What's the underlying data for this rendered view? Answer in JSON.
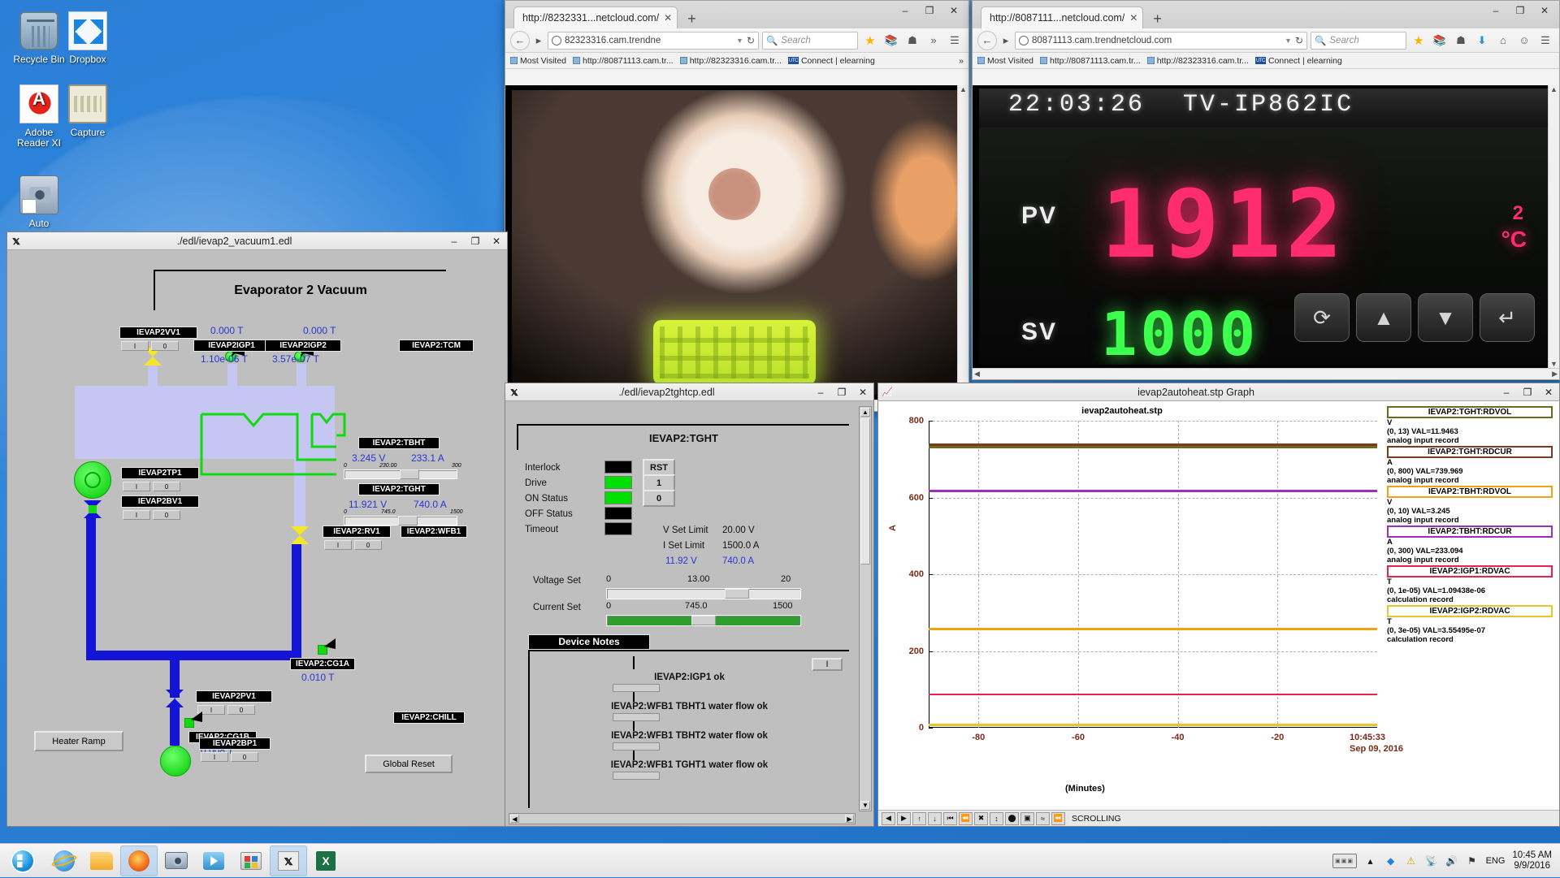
{
  "desktop": {
    "icons": [
      {
        "name": "recycle-bin",
        "label": "Recycle Bin"
      },
      {
        "name": "dropbox",
        "label": "Dropbox"
      },
      {
        "name": "adobe-reader",
        "label": "Adobe\nReader XI"
      },
      {
        "name": "capture",
        "label": "Capture"
      },
      {
        "name": "auto",
        "label": "Auto"
      }
    ]
  },
  "browser1": {
    "tab_label": "http://8232331...netcloud.com/",
    "new_tab": "+",
    "url": "82323316.cam.trendne",
    "url_bold": "trendne",
    "search_placeholder": "Search",
    "bookmarks": [
      {
        "label": "Most Visited"
      },
      {
        "label": "http://80871113.cam.tr..."
      },
      {
        "label": "http://82323316.cam.tr..."
      },
      {
        "label": "Connect | elearning"
      }
    ],
    "bookmarks_overflow": "»",
    "window_buttons": {
      "minimize": "–",
      "maximize": "❐",
      "close": "✕"
    }
  },
  "browser2": {
    "tab_label": "http://8087111...netcloud.com/",
    "new_tab": "+",
    "url": "80871113.cam.trendnetcloud.com",
    "search_placeholder": "Search",
    "bookmarks": [
      {
        "label": "Most Visited"
      },
      {
        "label": "http://80871113.cam.tr..."
      },
      {
        "label": "http://82323316.cam.tr..."
      },
      {
        "label": "Connect | elearning"
      }
    ],
    "window_buttons": {
      "minimize": "–",
      "maximize": "❐",
      "close": "✕"
    },
    "camera": {
      "timestamp": "22:03:26",
      "camera_id": "TV-IP862IC",
      "pv_label": "PV",
      "sv_label": "SV",
      "pv_value": "1912",
      "sv_value": "1000",
      "unit": "°C",
      "channel": "2",
      "keys": [
        "⟳",
        "▲",
        "▼",
        "↵"
      ]
    }
  },
  "vacuum_window": {
    "title": "./edl/ievap2_vacuum1.edl",
    "header": "Evaporator 2 Vacuum",
    "window_buttons": {
      "minimize": "–",
      "maximize": "❐",
      "close": "✕"
    },
    "devices": [
      {
        "name": "IEVAP2VV1",
        "on": "I",
        "off": "0"
      },
      {
        "name": "IEVAP2IGP1",
        "on": "I",
        "off": "0"
      },
      {
        "name": "IEVAP2IGP2",
        "on": "I",
        "off": "0"
      },
      {
        "name": "IEVAP2TP1",
        "on": "I",
        "off": "0"
      },
      {
        "name": "IEVAP2BV1",
        "on": "I",
        "off": "0"
      },
      {
        "name": "IEVAP2:RV1",
        "on": "I",
        "off": "0"
      },
      {
        "name": "IEVAP2PV1",
        "on": "I",
        "off": "0"
      },
      {
        "name": "IEVAP2:CG1B",
        "on": "I",
        "off": "0"
      },
      {
        "name": "IEVAP2BP1",
        "on": "I",
        "off": "0"
      }
    ],
    "labels": {
      "vv1": "IEVAP2VV1",
      "igp1": "IEVAP2IGP1",
      "igp2": "IEVAP2IGP2",
      "tcm": "IEVAP2:TCM",
      "tbht": "IEVAP2:TBHT",
      "tght": "IEVAP2:TGHT",
      "tp1": "IEVAP2TP1",
      "bv1": "IEVAP2BV1",
      "rv1": "IEVAP2:RV1",
      "wfb1": "IEVAP2:WFB1",
      "cg1a": "IEVAP2:CG1A",
      "pv1": "IEVAP2PV1",
      "cg1b": "IEVAP2:CG1B",
      "chill": "IEVAP2:CHILL",
      "bp1": "IEVAP2BP1"
    },
    "readings": {
      "vv1_top": "0.000 T",
      "igp1_top": "0.000 T",
      "igp1": "1.10e-06 T",
      "igp2": "3.57e-07 T",
      "tbht_v": "3.245 V",
      "tbht_a": "233.1 A",
      "tbht_scale_min": "0",
      "tbht_scale_mid": "230.00",
      "tbht_scale_max": "300",
      "tght_v": "11.921 V",
      "tght_a": "740.0 A",
      "tght_scale_min": "0",
      "tght_scale_mid": "745.0",
      "tght_scale_max": "1500",
      "cg1a": "0.010 T",
      "cg1b": "0.008 T"
    },
    "buttons": {
      "heater_ramp": "Heater Ramp",
      "global_reset": "Global Reset"
    }
  },
  "tght_window": {
    "title": "./edl/ievap2tghtcp.edl",
    "window_buttons": {
      "minimize": "–",
      "maximize": "❐",
      "close": "✕"
    },
    "header": "IEVAP2:TGHT",
    "status_rows": [
      {
        "label": "Interlock",
        "lamp": "black"
      },
      {
        "label": "Drive",
        "lamp": "green"
      },
      {
        "label": "ON Status",
        "lamp": "green"
      },
      {
        "label": "OFF Status",
        "lamp": "black"
      },
      {
        "label": "Timeout",
        "lamp": "black"
      }
    ],
    "buttons": {
      "rst": "RST",
      "one": "1",
      "zero": "0"
    },
    "limits": [
      {
        "label": "V Set Limit",
        "value": "20.00 V"
      },
      {
        "label": "I Set Limit",
        "value": "1500.0 A"
      }
    ],
    "readback": {
      "voltage": "11.92 V",
      "current": "740.0 A"
    },
    "voltage_set": {
      "label": "Voltage Set",
      "min": "0",
      "value": "13.00",
      "max": "20",
      "pct": 65
    },
    "current_set": {
      "label": "Current Set",
      "min": "0",
      "value": "745.0",
      "max": "1500",
      "pct": 49.7
    },
    "device_notes_label": "Device Notes",
    "notes_toggle": "I",
    "notes": [
      "IEVAP2:IGP1 ok",
      "IEVAP2:WFB1 TBHT1 water flow ok",
      "IEVAP2:WFB1 TBHT2 water flow ok",
      "IEVAP2:WFB1 TGHT1 water flow ok"
    ]
  },
  "graph_window": {
    "title": "ievap2autoheat.stp Graph",
    "window_buttons": {
      "minimize": "–",
      "maximize": "❐",
      "close": "✕"
    },
    "status": "SCROLLING",
    "toolbar_icons": [
      "◀",
      "▶",
      "↑",
      "↓",
      "⏮",
      "⏪",
      "✖",
      "↕",
      "⬤",
      "▣",
      "≈",
      "⏪"
    ],
    "legend": [
      {
        "name": "IEVAP2:TGHT:RDVOL",
        "unit": "V",
        "range": "(0, 13) VAL=11.9463",
        "rec": "analog input record",
        "color": "#6b6b1e"
      },
      {
        "name": "IEVAP2:TGHT:RDCUR",
        "unit": "A",
        "range": "(0, 800) VAL=739.969",
        "rec": "analog input record",
        "color": "#7a3b1e"
      },
      {
        "name": "IEVAP2:TBHT:RDVOL",
        "unit": "V",
        "range": "(0, 10) VAL=3.245",
        "rec": "analog input record",
        "color": "#f0a312"
      },
      {
        "name": "IEVAP2:TBHT:RDCUR",
        "unit": "A",
        "range": "(0, 300) VAL=233.094",
        "rec": "analog input record",
        "color": "#9b30c0"
      },
      {
        "name": "IEVAP2:IGP1:RDVAC",
        "unit": "T",
        "range": "(0, 1e-05) VAL=1.09438e-06",
        "rec": "calculation record",
        "color": "#e8234a"
      },
      {
        "name": "IEVAP2:IGP2:RDVAC",
        "unit": "T",
        "range": "(0, 3e-05) VAL=3.55495e-07",
        "rec": "calculation record",
        "color": "#e8c52a"
      }
    ]
  },
  "chart_data": {
    "type": "line",
    "title": "ievap2autoheat.stp",
    "xlabel": "(Minutes)",
    "ylabel": "A",
    "xlim": [
      -90,
      0
    ],
    "ylim": [
      0,
      800
    ],
    "yticks": [
      0,
      200,
      400,
      600,
      800
    ],
    "xticks": [
      "-80",
      "-60",
      "-40",
      "-20"
    ],
    "x_end_label": "10:45:33",
    "x_end_date": "Sep 09, 2016",
    "grid": true,
    "legend_position": "right",
    "series": [
      {
        "name": "IEVAP2:TGHT:RDCUR",
        "color": "#7a3b1e",
        "value": 739.969,
        "plot_y": 740
      },
      {
        "name": "IEVAP2:TGHT:RDVOL",
        "color": "#6b6b1e",
        "value": 11.9463,
        "plot_y": 735
      },
      {
        "name": "IEVAP2:TBHT:RDCUR",
        "color": "#9b30c0",
        "value": 233.094,
        "plot_y": 621
      },
      {
        "name": "IEVAP2:TBHT:RDVOL",
        "color": "#f0a312",
        "value": 3.245,
        "plot_y": 260
      },
      {
        "name": "IEVAP2:IGP1:RDVAC",
        "color": "#e8234a",
        "value": 1.09438e-06,
        "plot_y": 88
      },
      {
        "name": "IEVAP2:IGP2:RDVAC",
        "color": "#e8c52a",
        "value": 3.55495e-07,
        "plot_y": 10
      }
    ]
  },
  "taskbar": {
    "apps": [
      "internet-explorer",
      "file-explorer",
      "firefox",
      "camera",
      "media",
      "paint",
      "xterm",
      "excel"
    ],
    "tray": {
      "lang": "ENG",
      "time": "10:45 AM",
      "date": "9/9/2016"
    }
  }
}
